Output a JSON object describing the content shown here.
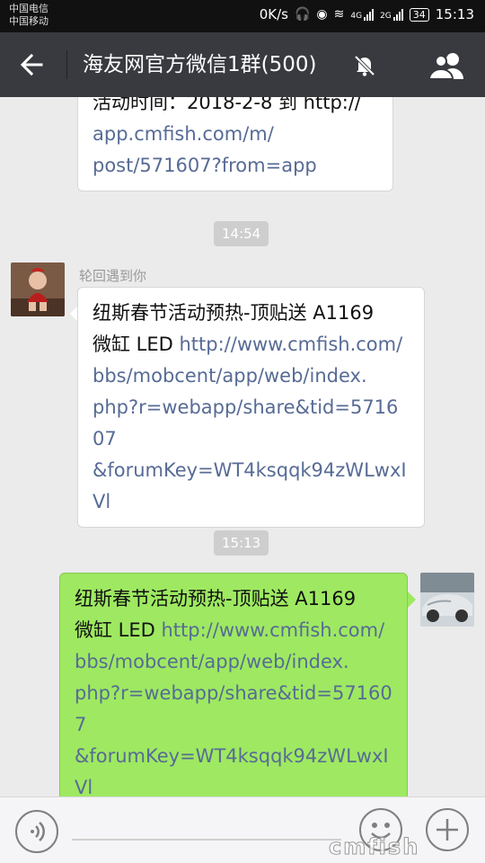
{
  "status_bar": {
    "carrier_1": "中国电信",
    "carrier_2": "中国移动",
    "net_speed": "0K/s",
    "net_type_1": "4G",
    "net_type_2": "2G",
    "battery": "34",
    "time": "15:13"
  },
  "header": {
    "title": "海友网官方微信1群(500)",
    "back_icon": "arrow-left-icon",
    "mute_icon": "bell-off-icon",
    "members_icon": "group-icon"
  },
  "messages": {
    "prev": {
      "line_cut": "活动时间：2018-2-8 到 http://",
      "link_rest_1": "app.cmfish.com/m/",
      "link_rest_2": "post/571607?from=app"
    },
    "time_1": "14:54",
    "incoming": {
      "sender": "轮回遇到你",
      "text_1": "纽斯春节活动预热-顶贴送 A1169",
      "text_2": "微缸 LED ",
      "link_1": "http://www.cmfish.com/",
      "link_2": "bbs/mobcent/app/web/index.",
      "link_3": "php?r=webapp/share&tid=571607",
      "link_4": "&forumKey=WT4ksqqk94zWLwxI",
      "link_5": "Vl"
    },
    "time_2": "15:13",
    "outgoing": {
      "text_1": "纽斯春节活动预热-顶贴送 A1169",
      "text_2": "微缸 LED ",
      "link_1": "http://www.cmfish.com/",
      "link_2": "bbs/mobcent/app/web/index.",
      "link_3": "php?r=webapp/share&tid=571607",
      "link_4": "&forumKey=WT4ksqqk94zWLwxI",
      "link_5": "Vl"
    }
  },
  "input_bar": {
    "voice_icon": "voice-icon",
    "emoji_icon": "emoji-icon",
    "plus_icon": "plus-icon",
    "watermark": "cmfish"
  },
  "colors": {
    "title_bg": "#393a3f",
    "chat_bg": "#ebebeb",
    "green_bubble": "#9ee961",
    "link": "#576b95"
  }
}
